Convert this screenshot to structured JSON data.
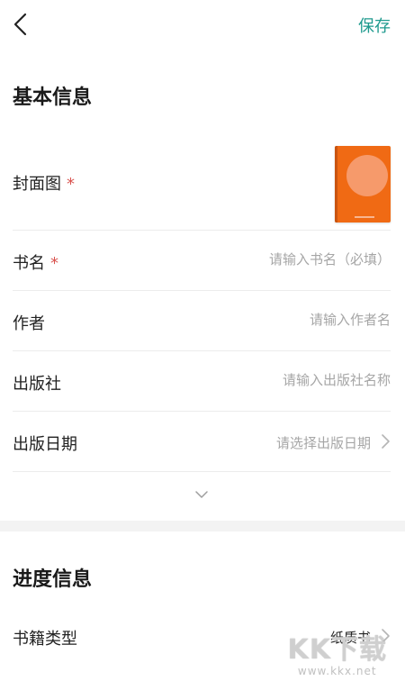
{
  "header": {
    "save_label": "保存"
  },
  "basic_info": {
    "title": "基本信息",
    "cover_label": "封面图",
    "required_mark": "*",
    "book_name": {
      "label": "书名",
      "placeholder": "请输入书名（必填）"
    },
    "author": {
      "label": "作者",
      "placeholder": "请输入作者名"
    },
    "publisher": {
      "label": "出版社",
      "placeholder": "请输入出版社名称"
    },
    "publish_date": {
      "label": "出版日期",
      "placeholder": "请选择出版日期"
    }
  },
  "progress_info": {
    "title": "进度信息",
    "book_type": {
      "label": "书籍类型",
      "value": "纸质书"
    }
  },
  "watermark": {
    "logo": "KK下载",
    "url": "www.kkx.net"
  },
  "colors": {
    "accent": "#1e9a8e",
    "required": "#d9534f",
    "cover": "#f06a14"
  },
  "icons": [
    "back-arrow-icon",
    "chevron-right-icon",
    "chevron-down-icon"
  ]
}
